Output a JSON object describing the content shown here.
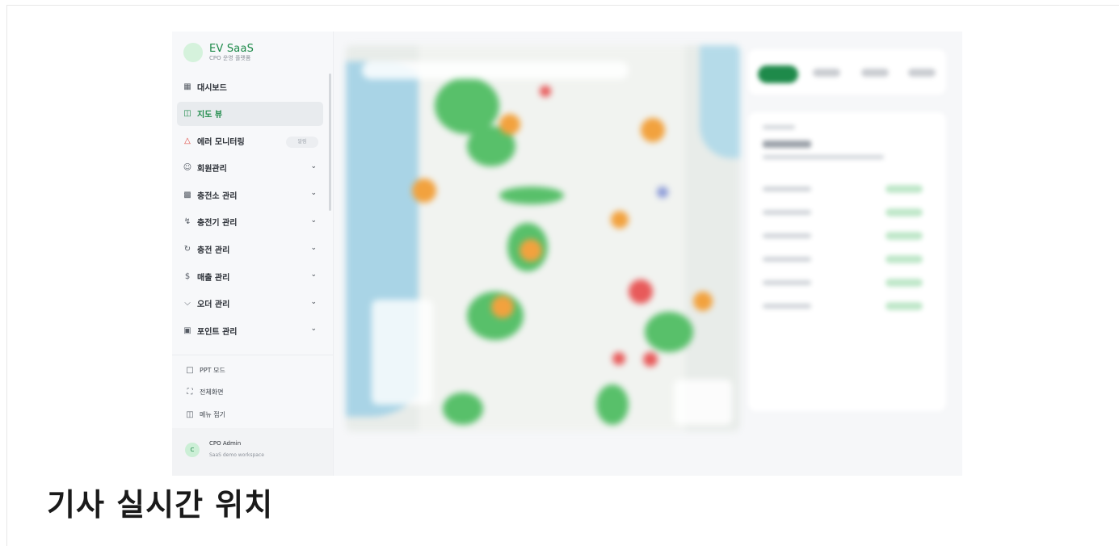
{
  "caption": "기사 실시간 위치",
  "brand": {
    "name": "EV SaaS",
    "subtitle": "CPO 운영 플랫폼"
  },
  "sidebar": {
    "items": [
      {
        "label": "대시보드",
        "icon": "grid-icon"
      },
      {
        "label": "지도 뷰",
        "icon": "map-icon",
        "active": true
      },
      {
        "label": "에러 모니터링",
        "icon": "warning-icon",
        "badge": "알림"
      },
      {
        "label": "회원관리",
        "icon": "users-icon",
        "expandable": true
      },
      {
        "label": "충전소 관리",
        "icon": "building-icon",
        "expandable": true
      },
      {
        "label": "충전기 관리",
        "icon": "bolt-icon",
        "expandable": true
      },
      {
        "label": "충전 관리",
        "icon": "history-icon",
        "expandable": true
      },
      {
        "label": "매출 관리",
        "icon": "dollar-icon",
        "expandable": true
      },
      {
        "label": "오더 관리",
        "icon": "cart-icon",
        "expandable": true
      },
      {
        "label": "포인트 관리",
        "icon": "gift-icon",
        "expandable": true
      }
    ],
    "utilities": [
      {
        "label": "PPT 모드",
        "icon": "presentation-icon"
      },
      {
        "label": "전체화면",
        "icon": "fullscreen-icon"
      },
      {
        "label": "메뉴 접기",
        "icon": "collapse-sidebar-icon"
      }
    ]
  },
  "user": {
    "initial": "C",
    "name": "CPO Admin",
    "workspace": "SaaS demo workspace"
  },
  "colors": {
    "accent": "#1e8a4a",
    "alert": "#e0443b"
  }
}
